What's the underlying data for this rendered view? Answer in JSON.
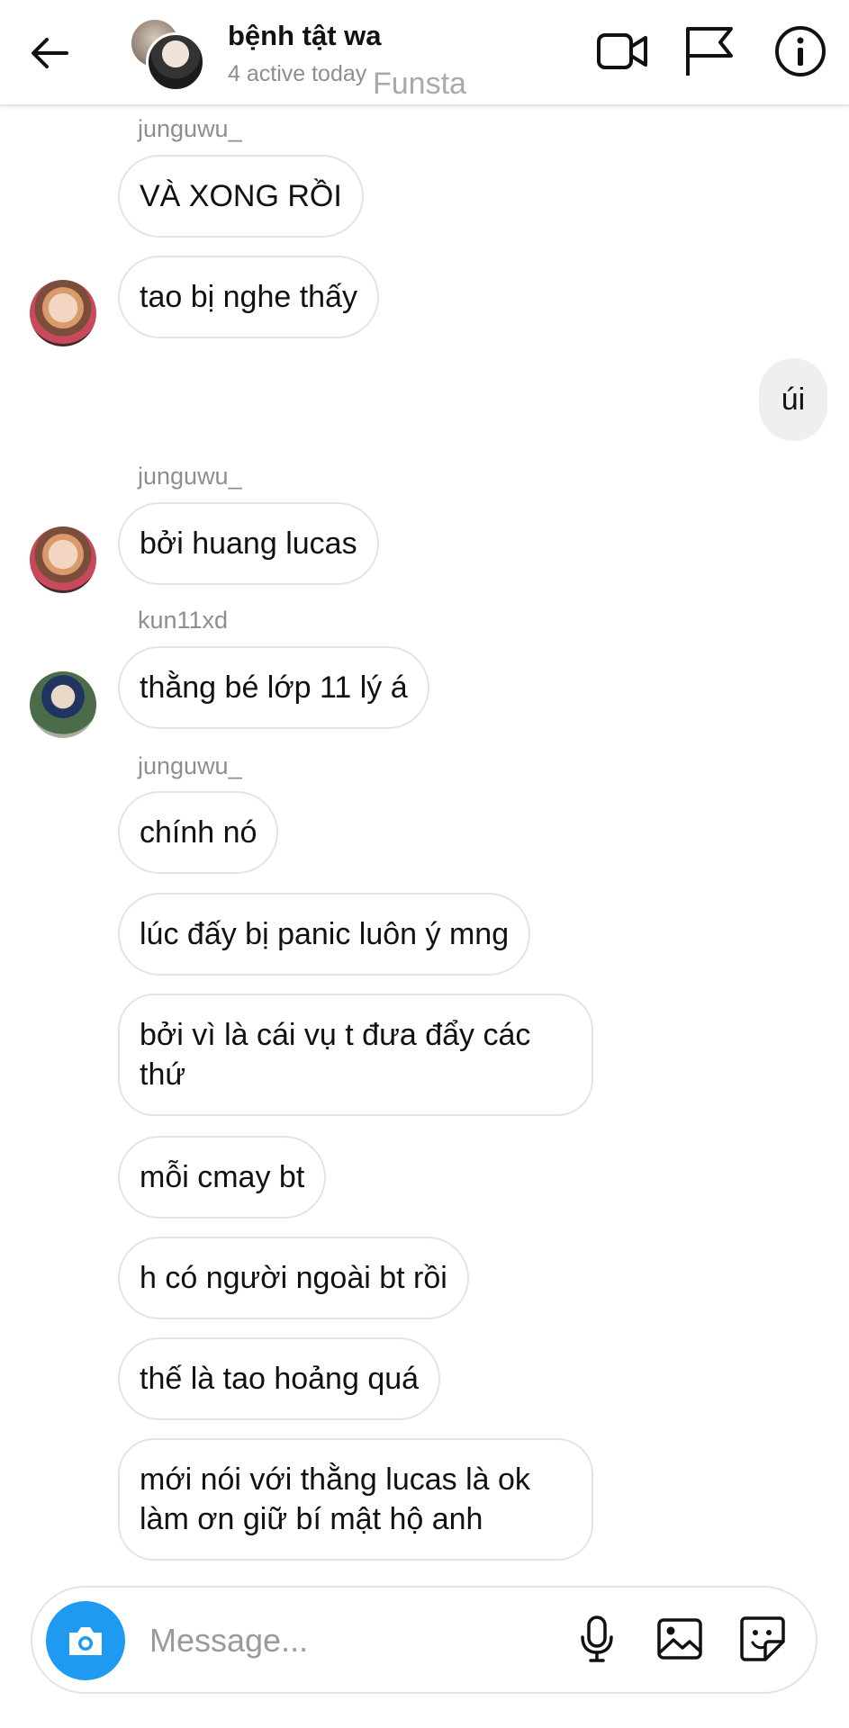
{
  "header": {
    "title": "bệnh tật wa",
    "status": "4 active today",
    "watermark": "Funsta"
  },
  "messages": [
    {
      "sender": "junguwu_",
      "text": "VÀ XONG RỒI"
    },
    {
      "text": "tao bị nghe thấy"
    },
    {
      "outgoing": true,
      "text": "úi"
    },
    {
      "sender": "junguwu_",
      "text": "bởi huang lucas"
    },
    {
      "sender": "kun11xd",
      "text": "thằng bé lớp 11 lý á"
    },
    {
      "sender": "junguwu_",
      "text": "chính nó"
    },
    {
      "text": "lúc đấy bị panic luôn ý mng"
    },
    {
      "text": "bởi vì là cái vụ t đưa đẩy các thứ"
    },
    {
      "text": "mỗi cmay bt"
    },
    {
      "text": "h có người ngoài bt rồi"
    },
    {
      "text": "thế là tao hoảng quá"
    },
    {
      "text": "mới nói với thằng lucas là ok làm ơn giữ bí mật hộ anh"
    }
  ],
  "composer": {
    "placeholder": "Message..."
  },
  "colors": {
    "accent": "#1e9bf0",
    "outgoing_bubble": "#efefef",
    "muted_text": "#8e8e8e"
  }
}
